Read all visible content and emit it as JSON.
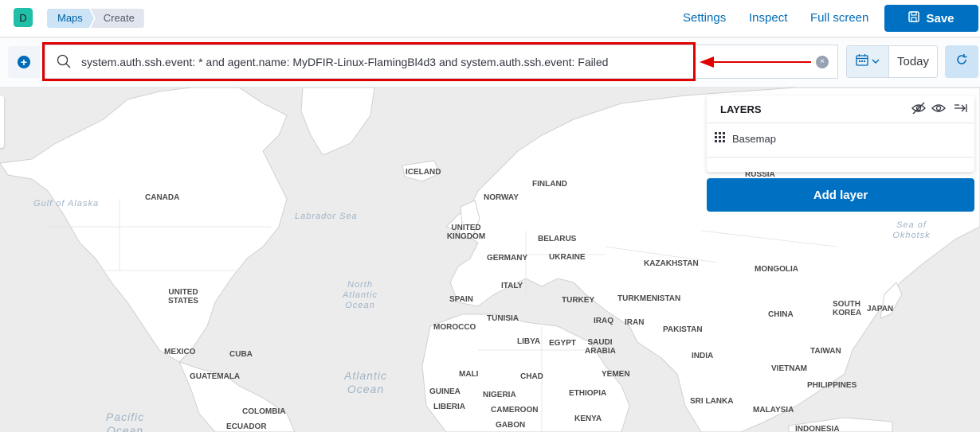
{
  "header": {
    "avatar_initial": "D",
    "breadcrumbs": [
      "Maps",
      "Create"
    ],
    "links": [
      "Settings",
      "Inspect",
      "Full screen"
    ],
    "save_label": "Save"
  },
  "query": {
    "text": "system.auth.ssh.event: * and agent.name: MyDFIR-Linux-FlamingBl4d3 and system.auth.ssh.event: Failed"
  },
  "datepicker": {
    "value": "Today"
  },
  "layers_panel": {
    "title": "LAYERS",
    "layers": [
      {
        "name": "Basemap"
      }
    ],
    "add_layer_label": "Add layer"
  },
  "map": {
    "countries": [
      "CANADA",
      "ICELAND",
      "FINLAND",
      "NORWAY",
      "RUSSIA",
      "UNITED KINGDOM",
      "BELARUS",
      "GERMANY",
      "UKRAINE",
      "KAZAKHSTAN",
      "MONGOLIA",
      "UNITED STATES",
      "ITALY",
      "SPAIN",
      "TURKEY",
      "TURKMENISTAN",
      "SOUTH KOREA",
      "JAPAN",
      "CHINA",
      "TUNISIA",
      "IRAQ",
      "IRAN",
      "MOROCCO",
      "LIBYA",
      "EGYPT",
      "SAUDI ARABIA",
      "PAKISTAN",
      "MEXICO",
      "CUBA",
      "INDIA",
      "TAIWAN",
      "GUATEMALA",
      "YEMEN",
      "MALI",
      "CHAD",
      "VIETNAM",
      "GUINEA",
      "NIGERIA",
      "ETHIOPIA",
      "PHILIPPINES",
      "LIBERIA",
      "SRI LANKA",
      "COLOMBIA",
      "CAMEROON",
      "MALAYSIA",
      "KENYA",
      "ECUADOR",
      "GABON",
      "INDONESIA"
    ],
    "seas": [
      "Gulf of Alaska",
      "Labrador Sea",
      "North Atlantic Ocean",
      "Atlantic Ocean",
      "Pacific Ocean",
      "Sea of Okhotsk"
    ]
  },
  "colors": {
    "accent": "#0071c2",
    "annotation": "#e00000",
    "land": "#ffffff",
    "water": "#ececec"
  }
}
